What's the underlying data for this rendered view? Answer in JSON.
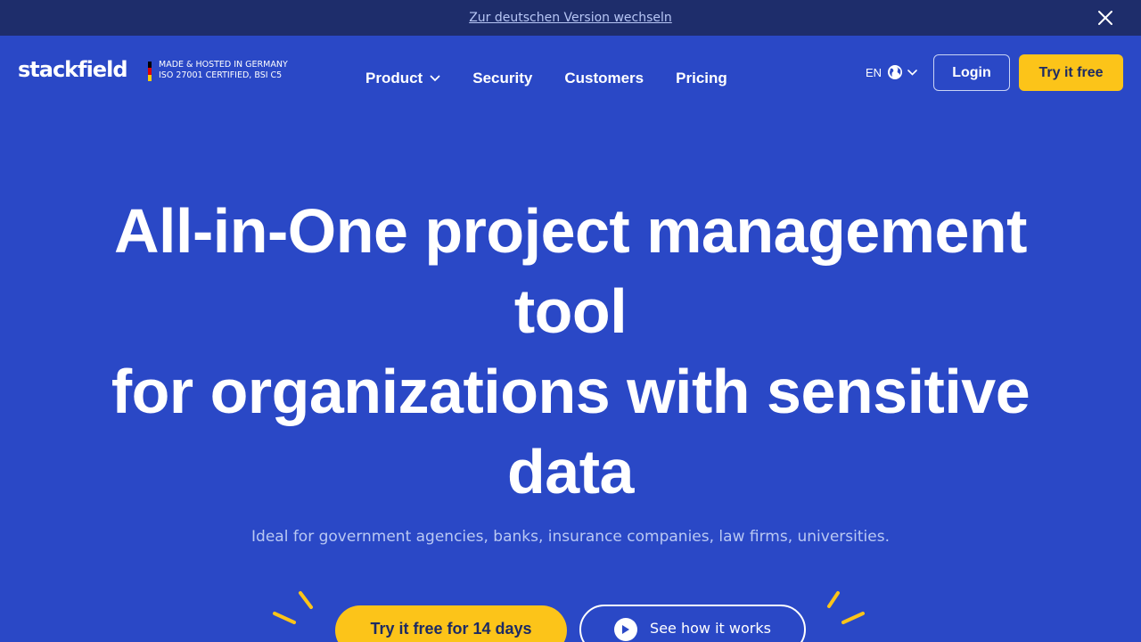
{
  "banner": {
    "link_text": "Zur deutschen Version wechseln",
    "close_icon": "close-icon"
  },
  "header": {
    "logo": "stackfield",
    "cert_line1": "MADE & HOSTED IN GERMANY",
    "cert_line2": "ISO 27001 CERTIFIED, BSI C5",
    "nav": [
      {
        "label": "Product",
        "has_dropdown": true
      },
      {
        "label": "Security"
      },
      {
        "label": "Customers"
      },
      {
        "label": "Pricing"
      }
    ],
    "language": "EN",
    "login_label": "Login",
    "try_label": "Try it free"
  },
  "hero": {
    "title_line1": "All-in-One project management",
    "title_line2": "tool",
    "title_line3": "for organizations with sensitive",
    "title_line4": "data",
    "subtitle": "Ideal for government agencies, banks, insurance companies, law firms, universities.",
    "cta_primary": "Try it free for 14 days",
    "cta_secondary": "See how it works"
  },
  "colors": {
    "background": "#2a48c6",
    "banner": "#1e2d6b",
    "accent_yellow": "#fcc419",
    "dark_text": "#1d2b63"
  }
}
